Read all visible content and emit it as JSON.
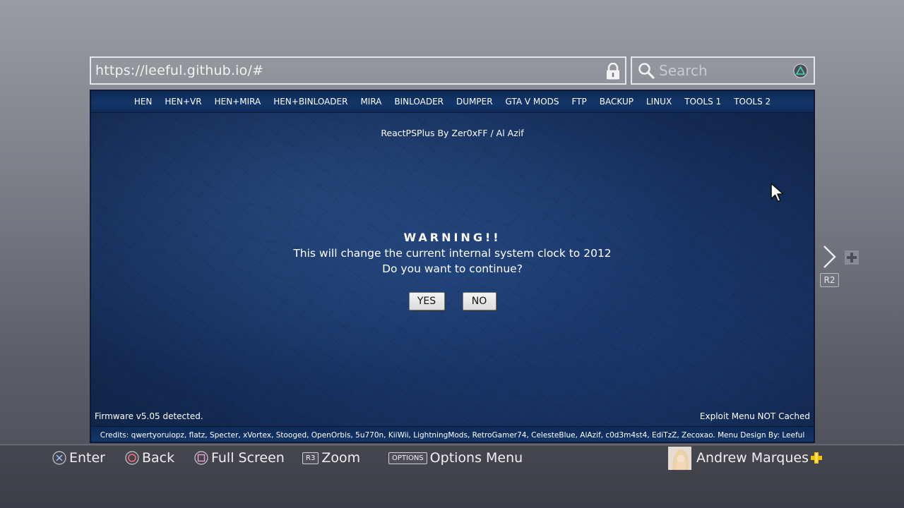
{
  "browser": {
    "url": "https://leeful.github.io/#",
    "search_placeholder": "Search"
  },
  "page": {
    "nav_items": [
      "HEN",
      "HEN+VR",
      "HEN+MIRA",
      "HEN+BINLOADER",
      "MIRA",
      "BINLOADER",
      "DUMPER",
      "GTA V MODS",
      "FTP",
      "BACKUP",
      "LINUX",
      "TOOLS 1",
      "TOOLS 2"
    ],
    "subtitle": "ReactPSPlus By Zer0xFF / Al Azif",
    "warning_title": "WARNING!!",
    "warning_line1": "This will change the current internal system clock to 2012",
    "warning_line2": "Do you want to continue?",
    "yes_label": "YES",
    "no_label": "NO",
    "firmware_text": "Firmware v5.05 detected.",
    "cache_text": "Exploit Menu NOT Cached",
    "credits": "Credits: qwertyoruiopz, flatz, Specter, xVortex, Stooged, OpenOrbis, 5u770n, KiiWii, LightningMods, RetroGamer74, CelesteBlue, AlAzif, c0d3m4st4, EdiTzZ, Zecoxao.  Menu Design By: Leeful"
  },
  "side_controls": {
    "r2_label": "R2"
  },
  "bottom_bar": {
    "enter_label": "Enter",
    "back_label": "Back",
    "fullscreen_label": "Full Screen",
    "r3_key": "R3",
    "zoom_label": "Zoom",
    "options_key": "OPTIONS",
    "options_label": "Options Menu",
    "user_name": "Andrew Marques"
  },
  "colors": {
    "ps_plus_gold": "#f2c400",
    "page_blue": "#1d3e74",
    "nav_blue": "#12366a"
  },
  "icons": [
    "lock-icon",
    "search-icon",
    "triangle-icon",
    "cursor-icon",
    "next-icon",
    "plus-icon",
    "cross-icon",
    "circle-icon",
    "square-icon",
    "ps-plus-icon"
  ]
}
